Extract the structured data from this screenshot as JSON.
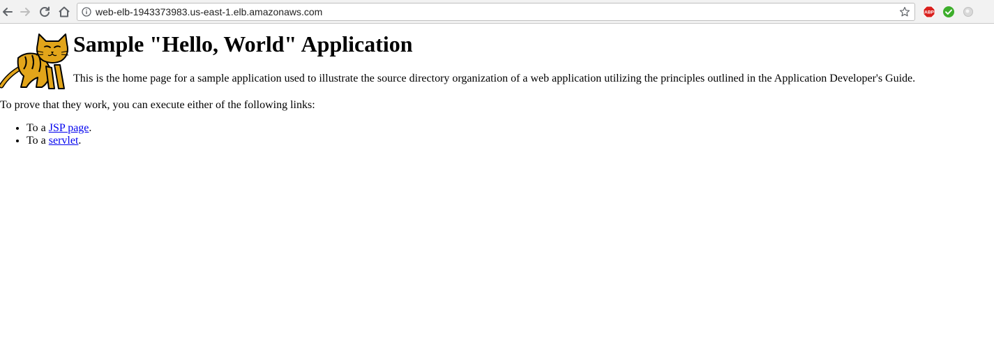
{
  "browser": {
    "url": "web-elb-1943373983.us-east-1.elb.amazonaws.com",
    "toolbar_icons": [
      "back-icon",
      "forward-icon",
      "reload-icon",
      "home-icon",
      "info-icon",
      "bookmark-star-icon"
    ],
    "extension_icons": [
      "adblock-plus-icon",
      "checkmark-extension-icon",
      "gray-circle-extension-icon"
    ],
    "extension_labels": {
      "adblock": "ABP"
    }
  },
  "page": {
    "logo_icon": "tomcat-logo",
    "title": "Sample \"Hello, World\" Application",
    "intro": "This is the home page for a sample application used to illustrate the source directory organization of a web application utilizing the principles outlined in the Application Developer's Guide.",
    "prove_text": "To prove that they work, you can execute either of the following links:",
    "links": [
      {
        "prefix": "To a ",
        "link_text": "JSP page",
        "suffix": "."
      },
      {
        "prefix": "To a ",
        "link_text": "servlet",
        "suffix": "."
      }
    ]
  },
  "colors": {
    "link": "#0000ee",
    "toolbar_bg": "#f2f2f2",
    "adblock_red": "#d9201d",
    "check_green": "#3dae2b",
    "logo_gold": "#e2a51a"
  }
}
